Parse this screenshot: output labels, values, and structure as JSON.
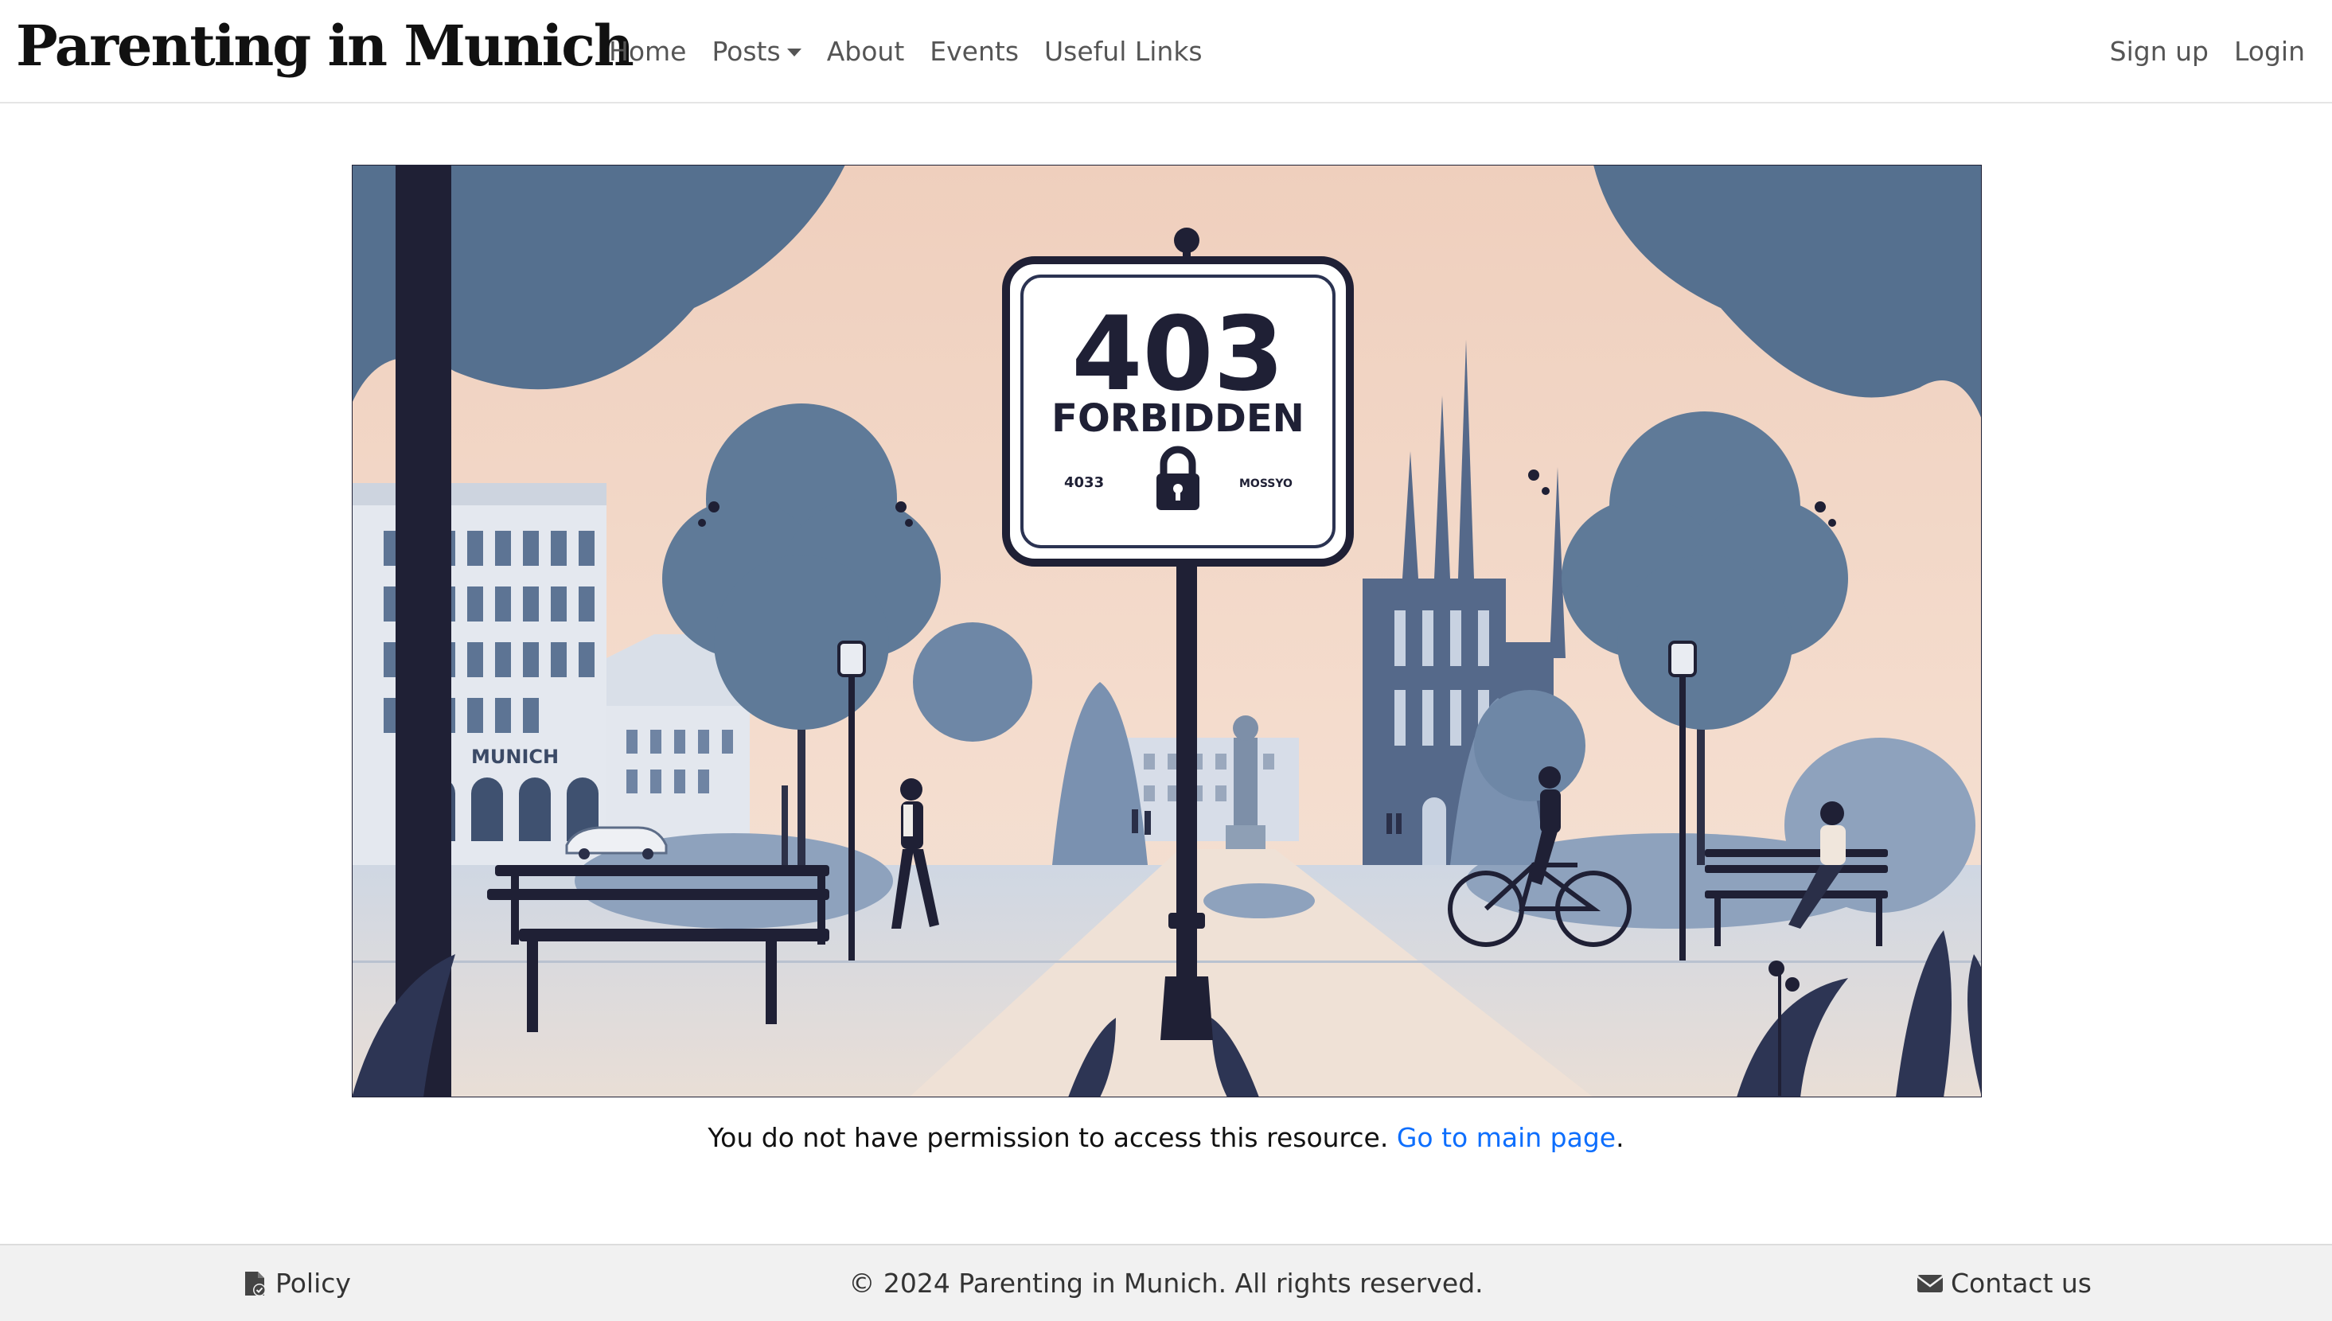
{
  "nav": {
    "brand": "Parenting in Munich",
    "links": [
      "Home",
      "Posts",
      "About",
      "Events",
      "Useful Links"
    ],
    "right": [
      "Sign up",
      "Login"
    ]
  },
  "hero": {
    "sign_code": "403",
    "sign_text": "FORBIDDEN",
    "sign_small_left": "4033",
    "sign_small_right": "MOSSYO",
    "building_sign": "MUNICH"
  },
  "message": {
    "text": "You do not have permission to access this resource.",
    "link": "Go to main page",
    "end": "."
  },
  "footer": {
    "policy": "Policy",
    "copyright": "© 2024 Parenting in Munich. All rights reserved.",
    "contact": "Contact us"
  },
  "colors": {
    "link": "#0d6efd",
    "navy": "#2b3352",
    "sky": "#f3d8c6",
    "tree": "#5f7a98"
  }
}
